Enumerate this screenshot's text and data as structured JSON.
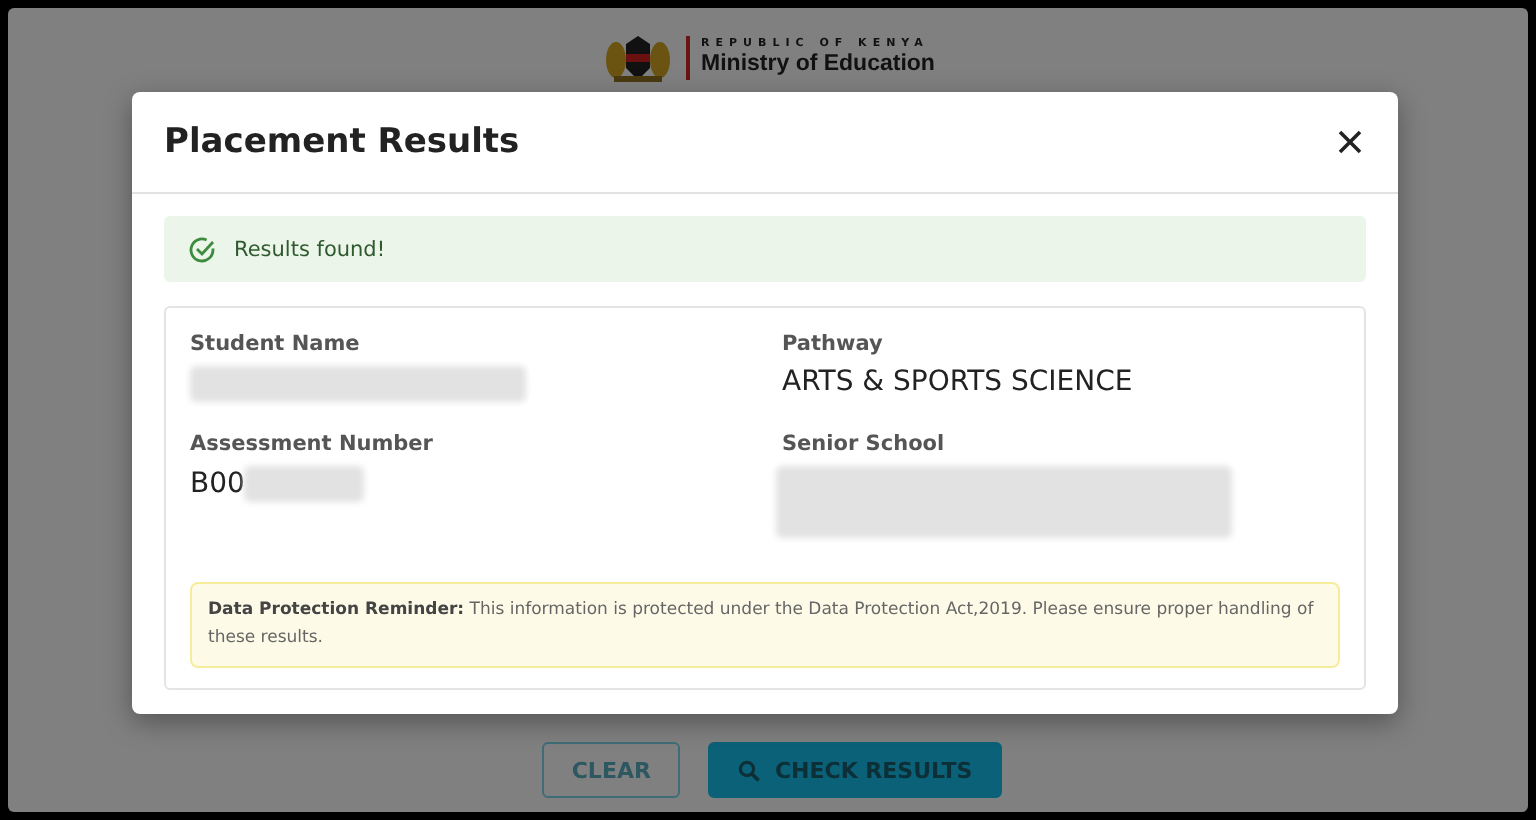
{
  "header": {
    "country": "REPUBLIC OF KENYA",
    "ministry": "Ministry of Education"
  },
  "modal": {
    "title": "Placement Results",
    "alert": {
      "kind": "success",
      "text": "Results found!"
    },
    "fields": [
      {
        "label": "Student Name",
        "kind": "redacted"
      },
      {
        "label": "Pathway",
        "kind": "text",
        "value": "ARTS & SPORTS SCIENCE"
      },
      {
        "label": "Assessment Number",
        "kind": "partial",
        "value": "B00"
      },
      {
        "label": "Senior School",
        "kind": "redacted_long"
      }
    ],
    "notice": "**Data Protection Reminder:** This information is protected under the Data Protection Act,2019. Please ensure proper handling of these results."
  },
  "buttons": [
    {
      "label": "CLEAR",
      "kind": "outline"
    },
    {
      "label": "CHECK RESULTS",
      "kind": "primary"
    }
  ]
}
